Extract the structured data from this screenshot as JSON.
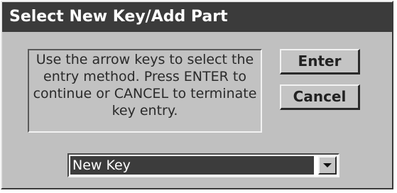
{
  "window": {
    "title": "Select New Key/Add Part"
  },
  "message": {
    "text": "Use the arrow keys to select the\nentry method. Press ENTER to\ncontinue or CANCEL to terminate\nkey entry."
  },
  "buttons": {
    "enter_label": "Enter",
    "cancel_label": "Cancel"
  },
  "entry_method": {
    "selected": "New Key",
    "arrow_icon": "chevron-down-icon"
  }
}
